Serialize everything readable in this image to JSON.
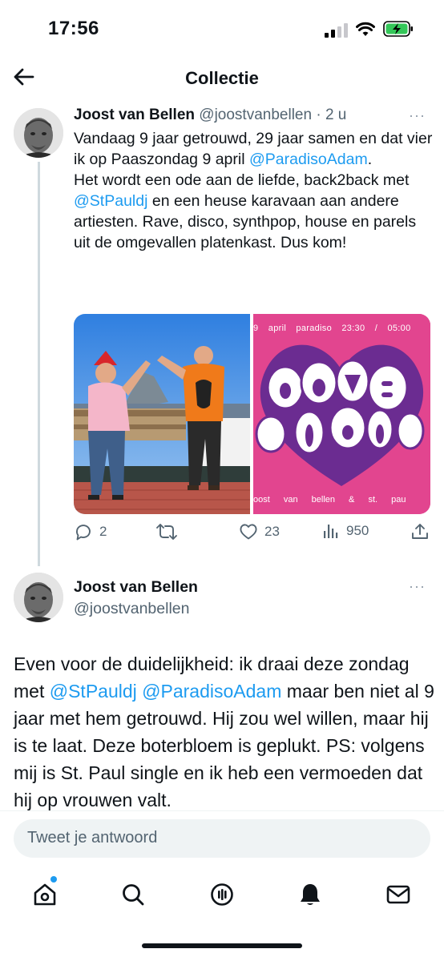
{
  "status_bar": {
    "time": "17:56"
  },
  "header": {
    "title": "Collectie"
  },
  "tweet1": {
    "name": "Joost van Bellen",
    "handle": "@joostvanbellen",
    "separator": " · ",
    "time": "2 u",
    "more": "···",
    "text": {
      "line1_a": "Vandaag 9 jaar getrouwd, 29 jaar samen en dat vier ik op Paaszondag 9 april ",
      "line1_mention": "@ParadisoAdam",
      "line1_b": ".",
      "line2_a": "Het wordt een ode aan de liefde, back2back met ",
      "line2_mention": "@StPauldj",
      "line2_b": " en een heuse karavaan aan andere artiesten. Rave, disco, synthpop, house en parels uit de omgevallen platenkast. Dus kom!"
    },
    "media": {
      "poster_top": "9 april paradiso 23:30 / 05:00",
      "poster_bottom": "oost van bellen & st. pau",
      "poster_art": "LOVE IS ALL"
    },
    "actions": {
      "replies": "2",
      "retweets": "",
      "likes": "23",
      "views": "950"
    }
  },
  "tweet2": {
    "name": "Joost van Bellen",
    "handle": "@joostvanbellen",
    "more": "···",
    "text": {
      "a": "Even voor de duidelijkheid: ik draai deze zondag met ",
      "mention1": "@StPauldj",
      "space": " ",
      "mention2": "@ParadisoAdam",
      "b": " maar ben niet al 9 jaar met hem getrouwd. Hij zou wel willen, maar hij is te laat. Deze boterbloem is geplukt. PS: volgens mij is St. Paul single en ik heb een vermoeden dat hij op vrouwen valt."
    }
  },
  "reply": {
    "placeholder": "Tweet je antwoord"
  },
  "colors": {
    "link": "#1d9bf0",
    "muted": "#536471",
    "poster_bg": "#e2458f",
    "poster_purple": "#6b2c91"
  }
}
